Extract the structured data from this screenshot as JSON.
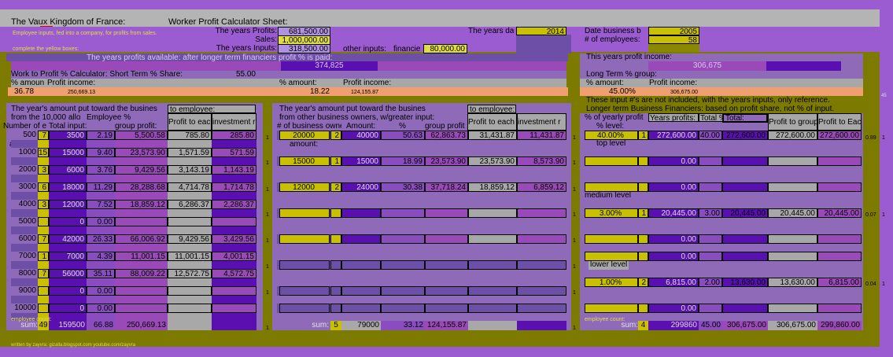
{
  "header": {
    "title": "The Vaux Kingdom of France:",
    "sheet": "Worker Profit Calculator Sheet:"
  },
  "notes": {
    "inputs_note": "Employee inputs, fed into a company, for profits from sales.",
    "yellow_note": "complete the yellow boxes:",
    "credit": "written by zayvra: gizalla.blogspot.com youtube.com/zayvra"
  },
  "inputs": {
    "profits_label": "The years Profits:",
    "profits_value": "681,500.00",
    "sales_label": "Sales:",
    "sales_value": "1,000,000.00",
    "years_inputs_label": "The years Inputs:",
    "years_inputs_value": "318,500.00",
    "other_inputs_label": "other inputs:",
    "financier_label": "financie",
    "financier_value": "80,000.00",
    "year_label": "The years da",
    "year_value": "2014",
    "date_label": "Date business b",
    "date_value": "2005",
    "employees_label": "# of employees:",
    "employees_value": "58"
  },
  "available": {
    "label": "The years profits available: after longer term financiers profit % is paid:",
    "value": "374,825"
  },
  "short_term": {
    "work_label": "Work to Profit %  Calculator: Short Term % Share:",
    "share": "55.00",
    "amount_label": "% amoun",
    "income_label": "Profit income:",
    "amount_value": "36.78",
    "income_value": "250,669.13",
    "amount2_label": "% amount:",
    "income2_label": "Profit income:",
    "amount2_value": "18.22",
    "income2_value": "124,155.87"
  },
  "long_term": {
    "income_label": "This years profit income:",
    "income_value": "306,675",
    "group_label": "Long Term % group:",
    "amount_label": "% amount:",
    "profit_label": "Profit income:",
    "amount_value": "45.00%",
    "profit_value": "306,675.00",
    "note1": "These input #'s are not included, with the years inputs, only reference.",
    "note2": "Longer term Business Financiers: based on profit share, not % of input."
  },
  "table1": {
    "title1": "The year's amount put toward the busines",
    "title2": "from the 10,000 allo",
    "to_emp": "to employee:",
    "emp_pct": "Employee %",
    "headers": [
      "Number of e",
      "Total input:",
      "",
      "group profit:",
      "Profit to each",
      "investment r"
    ],
    "amount_label": "amount:",
    "rows": [
      [
        "500",
        "7",
        "3500",
        "2.19",
        "5,500.58",
        "785.80",
        "285.80"
      ],
      [
        "1000",
        "15",
        "15000",
        "9.40",
        "23,573.90",
        "1,571.59",
        "571.59"
      ],
      [
        "2000",
        "3",
        "6000",
        "3.76",
        "9,429.56",
        "3,143.19",
        "1,143.19"
      ],
      [
        "3000",
        "6",
        "18000",
        "11.29",
        "28,288.68",
        "4,714.78",
        "1,714.78"
      ],
      [
        "4000",
        "3",
        "12000",
        "7.52",
        "18,859.12",
        "6,286.37",
        "2,286.37"
      ],
      [
        "5000",
        "",
        "0",
        "0.00",
        "",
        "",
        ""
      ],
      [
        "6000",
        "7",
        "42000",
        "26.33",
        "66,006.92",
        "9,429.56",
        "3,429.56"
      ],
      [
        "7000",
        "1",
        "7000",
        "4.39",
        "11,001.15",
        "11,001.15",
        "4,001.15"
      ],
      [
        "8000",
        "7",
        "56000",
        "35.11",
        "88,009.22",
        "12,572.75",
        "4,572.75"
      ],
      [
        "9000",
        "",
        "0",
        "0.00",
        "",
        "",
        ""
      ],
      [
        "10000",
        "",
        "0",
        "0.00",
        "",
        "",
        ""
      ]
    ],
    "count_label": "employee count:",
    "sum": {
      "label": "sum:",
      "count": "49",
      "input": "159500",
      "pct": "66.88",
      "group": "250,669.13"
    }
  },
  "table2": {
    "title1": "The year's amount put toward the busines",
    "title2": "from other business owners, w/greater input:",
    "to_emp": "to employee:",
    "headers": [
      "# of business owne",
      "Amount:",
      "%",
      "group profit",
      "Profit to each",
      "investment r"
    ],
    "amount_label": "amount:",
    "rows": [
      [
        "20000",
        "2",
        "40000",
        "50.63",
        "62,863.73",
        "31,431.87",
        "11,431.87"
      ],
      [
        "15000",
        "1",
        "15000",
        "18.99",
        "23,573.90",
        "23,573.90",
        "8,573.90"
      ],
      [
        "12000",
        "2",
        "24000",
        "30.38",
        "37,718.24",
        "18,859.12",
        "6,859.12"
      ]
    ],
    "sum": {
      "label": "sum:",
      "count": "5",
      "input": "79000",
      "pct": "33.12",
      "group": "124,155.87"
    }
  },
  "table3": {
    "headers": [
      "% of yearly profit",
      "Years profits:",
      "Total %",
      "Total:",
      "Profit to group",
      "Profit to Eac"
    ],
    "level_label": "% level:",
    "levels": [
      "top level",
      "medium level",
      "lower  level"
    ],
    "rows": [
      [
        "40.00%",
        "1",
        "272,600.00",
        "40.00",
        "272,600.00",
        "272,600.00",
        "272,600.00"
      ],
      [
        "",
        "",
        "0.00",
        "",
        "",
        "",
        ""
      ],
      [
        "",
        "",
        "0.00",
        "",
        "",
        "",
        ""
      ],
      [
        "3.00%",
        "1",
        "20,445.00",
        "3.00",
        "20,445.00",
        "20,445.00",
        "20,445.00"
      ],
      [
        "",
        "",
        "0.00",
        "",
        "",
        "",
        ""
      ],
      [
        "",
        "",
        "0.00",
        "",
        "",
        "",
        ""
      ],
      [
        "1.00%",
        "2",
        "6,815.00",
        "2.00",
        "13,630.00",
        "13,630.00",
        "6,815.00"
      ],
      [
        "",
        "",
        "0.00",
        "",
        "",
        "",
        ""
      ]
    ],
    "count_label": "employee count:",
    "sum": {
      "label": "sum:",
      "count": "4",
      "input": "299860",
      "pct": "45.00",
      "total": "306,675.00",
      "group": "306,675.00",
      "each": "299,860.00"
    }
  },
  "side_values": {
    "ones": "1",
    "a": "0.89",
    "b": "0.07",
    "c": "0.04",
    "far": "45"
  }
}
